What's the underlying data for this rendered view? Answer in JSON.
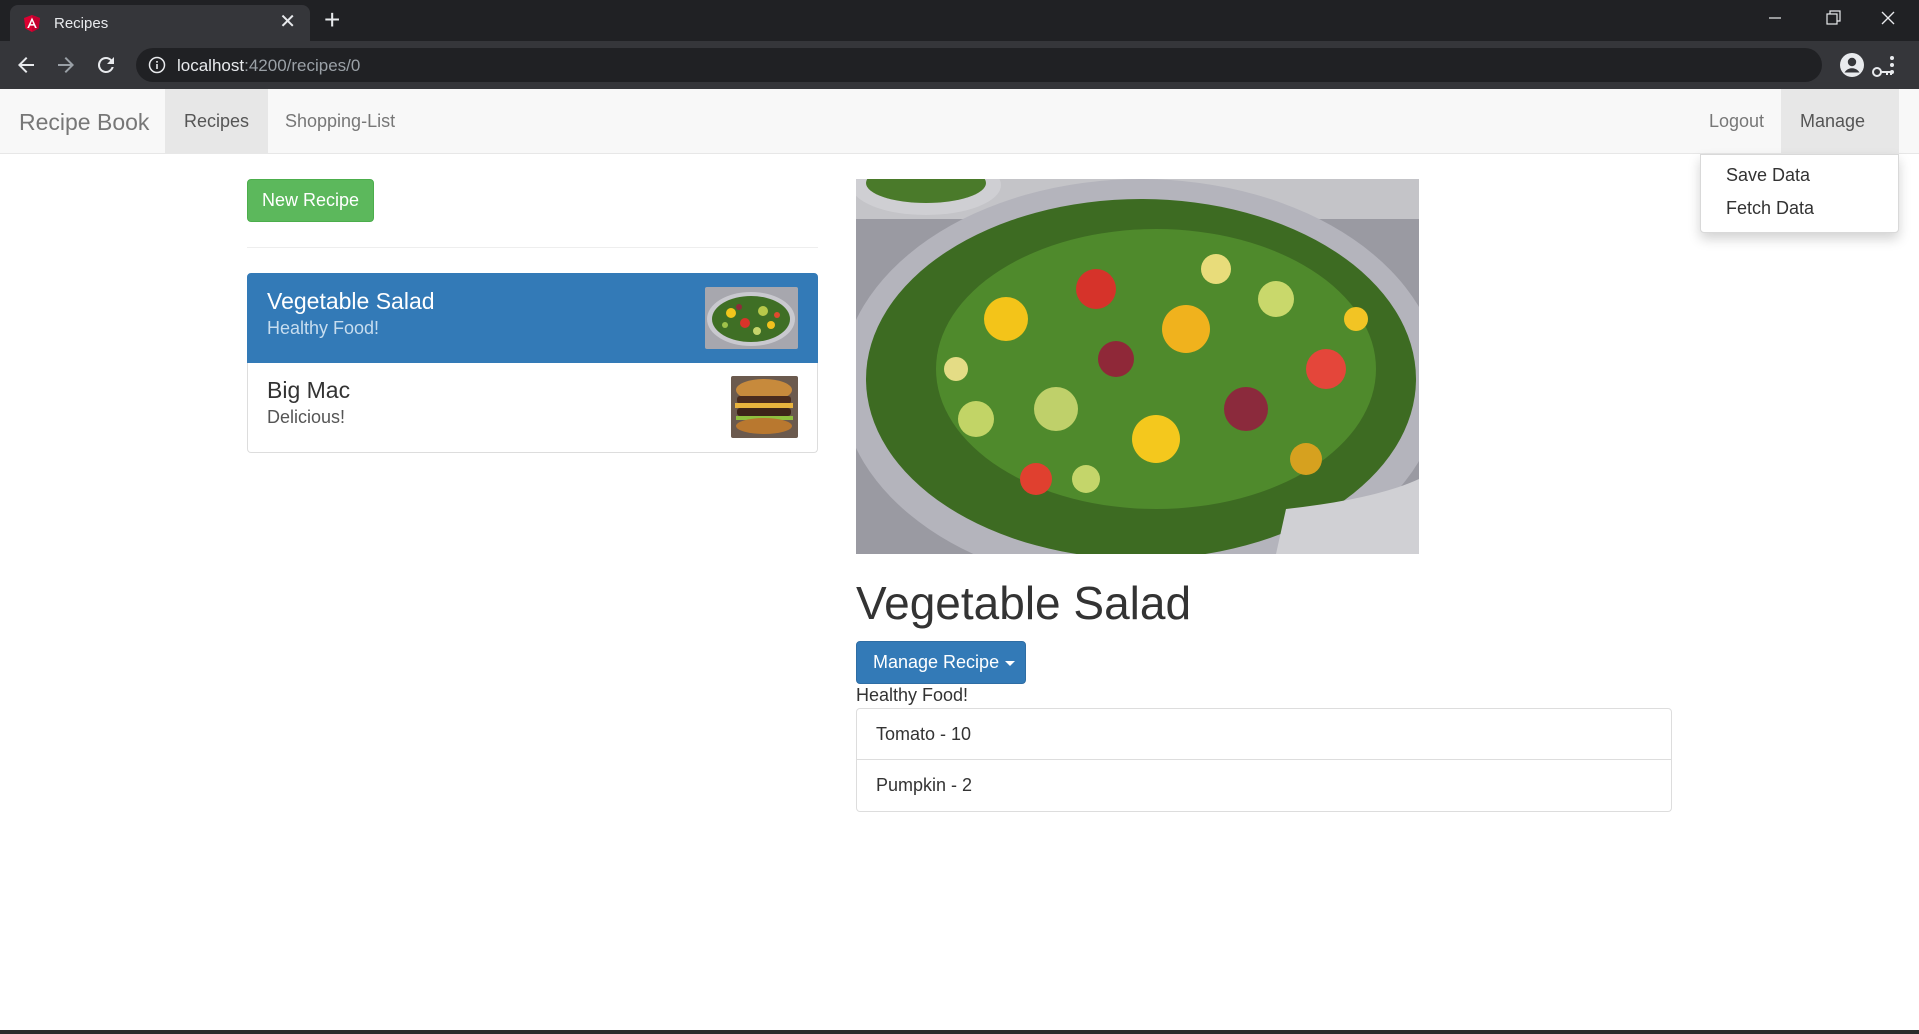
{
  "browser": {
    "tab_title": "Recipes",
    "url_host": "localhost",
    "url_path": ":4200/recipes/0"
  },
  "navbar": {
    "brand": "Recipe Book",
    "links": [
      {
        "label": "Recipes",
        "active": true
      },
      {
        "label": "Shopping-List",
        "active": false
      }
    ],
    "logout": "Logout",
    "manage": "Manage",
    "dropdown": [
      "Save Data",
      "Fetch Data"
    ]
  },
  "sidebar": {
    "new_recipe": "New Recipe",
    "recipes": [
      {
        "name": "Vegetable Salad",
        "description": "Healthy Food!",
        "active": true
      },
      {
        "name": "Big Mac",
        "description": "Delicious!",
        "active": false
      }
    ]
  },
  "detail": {
    "name": "Vegetable Salad",
    "manage_button": "Manage Recipe",
    "description": "Healthy Food!",
    "ingredients": [
      "Tomato - 10",
      "Pumpkin - 2"
    ]
  },
  "colors": {
    "success": "#5cb85c",
    "primary": "#337ab7",
    "chrome_dark": "#202124"
  }
}
